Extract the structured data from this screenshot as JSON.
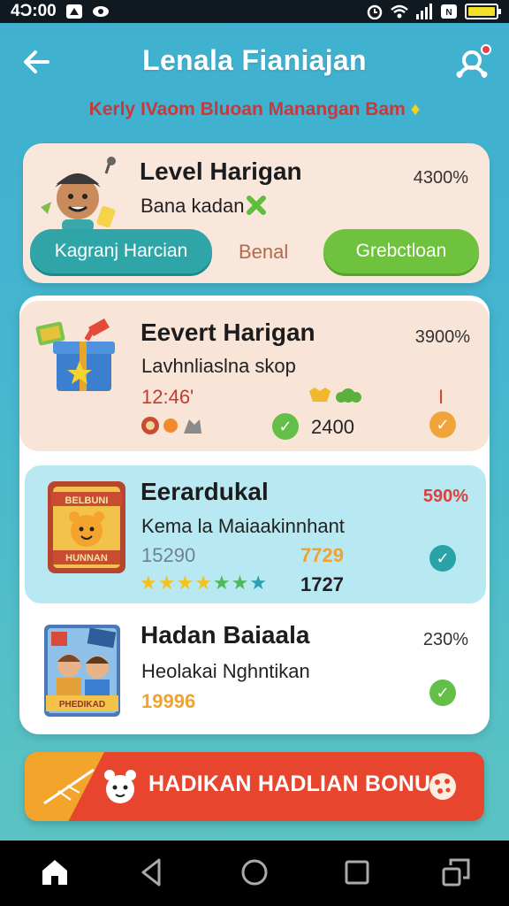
{
  "status_bar": {
    "time": "4Ɔ:00"
  },
  "header": {
    "title": "Lenala Fianiajan",
    "subtitle": "Kerly IVaom Bluoan Manangan Bam",
    "subtitle_star": "♦"
  },
  "cards": {
    "level": {
      "title": "Level Harigan",
      "subtitle": "Bana kadan",
      "percent": "4300%",
      "primary_button": "Kagranj Harcian",
      "middle_button": "Benal",
      "secondary_button": "Grebctloan"
    },
    "event": {
      "title": "Eevert Harigan",
      "subtitle": "Lavhnliaslna skop",
      "percent": "3900%",
      "value_left": "12:46'",
      "value_right": "2400",
      "marker": "I"
    },
    "reward": {
      "title": "Eerardukal",
      "subtitle": "Kema la Maiaakinnhant",
      "percent": "590%",
      "value_left": "15290",
      "value_mid": "7729",
      "value_stars": "1727",
      "badge_top": "BELBUNI",
      "badge_bottom": "HUNNAN"
    },
    "hadan": {
      "title": "Hadan Baiaala",
      "subtitle": "Heolakai Nghntikan",
      "percent": "230%",
      "value": "19996",
      "badge": "PHEDIKAD"
    }
  },
  "bonus": {
    "label": "HADIKAN HADLIAN BONUS"
  },
  "colors": {
    "accent_teal": "#2fa5a8",
    "accent_green": "#6ec23e",
    "bonus_red": "#e7452e",
    "highlight_red": "#d9413b"
  }
}
